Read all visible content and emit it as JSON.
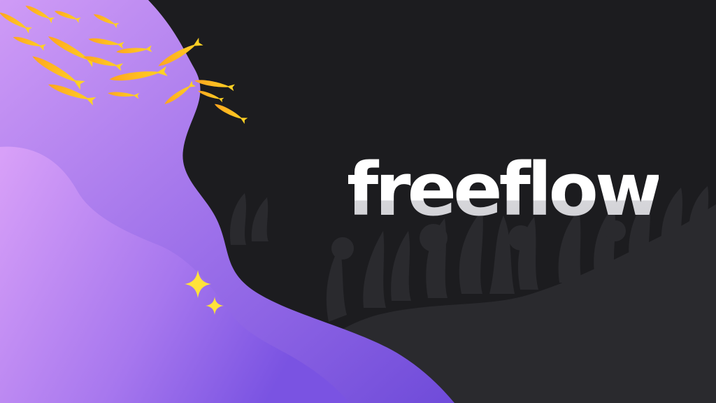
{
  "brand": {
    "name": "freeflow"
  },
  "colors": {
    "background": "#1c1c1f",
    "coral_silhouette": "#2a2a2e",
    "wave_purple_deep": "#7b52e0",
    "wave_purple_light": "#d69cf7",
    "fish_yellow": "#ffd21e",
    "fish_orange": "#ffa51f",
    "sparkle": "#ffe23a",
    "wordmark": "#ffffff"
  },
  "icons": {
    "fish": "fish-icon",
    "sparkle": "sparkle-icon"
  }
}
